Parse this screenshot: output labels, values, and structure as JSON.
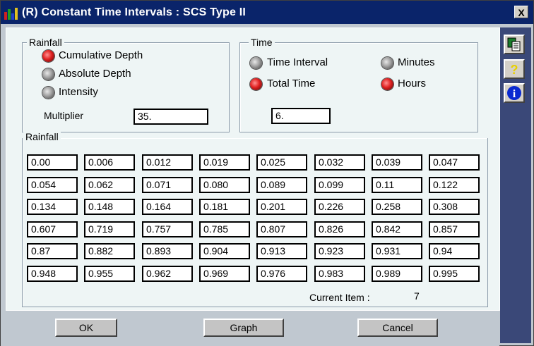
{
  "window": {
    "title": "(R) Constant Time Intervals : SCS Type II",
    "close_label": "X"
  },
  "rainfall_group": {
    "label": "Rainfall",
    "options": [
      {
        "label": "Cumulative Depth",
        "selected": true
      },
      {
        "label": "Absolute Depth",
        "selected": false
      },
      {
        "label": "Intensity",
        "selected": false
      }
    ],
    "multiplier_label": "Multiplier",
    "multiplier_value": "35."
  },
  "time_group": {
    "label": "Time",
    "options_left": [
      {
        "label": "Time Interval",
        "selected": false
      },
      {
        "label": "Total Time",
        "selected": true
      }
    ],
    "options_right": [
      {
        "label": "Minutes",
        "selected": false
      },
      {
        "label": "Hours",
        "selected": true
      }
    ],
    "value": "6."
  },
  "rainfall_table": {
    "label": "Rainfall",
    "rows": [
      [
        "0.00",
        "0.006",
        "0.012",
        "0.019",
        "0.025",
        "0.032",
        "0.039",
        "0.047"
      ],
      [
        "0.054",
        "0.062",
        "0.071",
        "0.080",
        "0.089",
        "0.099",
        "0.11",
        "0.122"
      ],
      [
        "0.134",
        "0.148",
        "0.164",
        "0.181",
        "0.201",
        "0.226",
        "0.258",
        "0.308"
      ],
      [
        "0.607",
        "0.719",
        "0.757",
        "0.785",
        "0.807",
        "0.826",
        "0.842",
        "0.857"
      ],
      [
        "0.87",
        "0.882",
        "0.893",
        "0.904",
        "0.913",
        "0.923",
        "0.931",
        "0.94"
      ],
      [
        "0.948",
        "0.955",
        "0.962",
        "0.969",
        "0.976",
        "0.983",
        "0.989",
        "0.995"
      ]
    ]
  },
  "current_item": {
    "label": "Current Item :",
    "value": "7"
  },
  "buttons": {
    "ok": "OK",
    "graph": "Graph",
    "cancel": "Cancel"
  },
  "sidebar": {
    "buttons": [
      "copy-icon",
      "help-icon",
      "info-icon"
    ]
  },
  "colors": {
    "title_bar": "#0a246a",
    "selected_radio": "#e02020",
    "sidebar": "#3a4878"
  }
}
